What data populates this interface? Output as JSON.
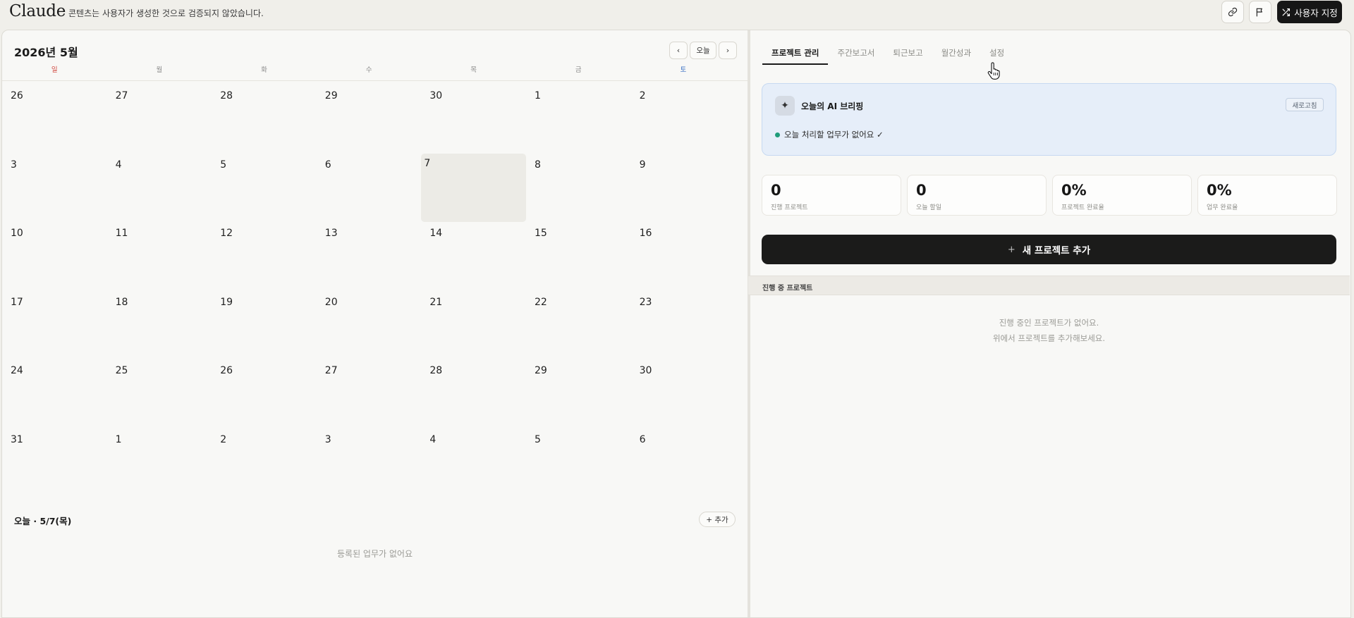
{
  "app": {
    "brand": "Claude",
    "disclaimer": "콘텐츠는 사용자가 생성한 것으로 검증되지 않았습니다.",
    "customize_label": "사용자 지정"
  },
  "calendar": {
    "title": "2026년 5월",
    "today_label": "오늘",
    "weekdays": [
      "일",
      "월",
      "화",
      "수",
      "목",
      "금",
      "토"
    ],
    "weeks": [
      [
        "26",
        "27",
        "28",
        "29",
        "30",
        "1",
        "2"
      ],
      [
        "3",
        "4",
        "5",
        "6",
        "7",
        "8",
        "9"
      ],
      [
        "10",
        "11",
        "12",
        "13",
        "14",
        "15",
        "16"
      ],
      [
        "17",
        "18",
        "19",
        "20",
        "21",
        "22",
        "23"
      ],
      [
        "24",
        "25",
        "26",
        "27",
        "28",
        "29",
        "30"
      ],
      [
        "31",
        "1",
        "2",
        "3",
        "4",
        "5",
        "6"
      ]
    ],
    "highlighted_day": "7"
  },
  "today_panel": {
    "title": "오늘 · 5/7(목)",
    "add_label": "+ 추가",
    "empty_text": "등록된 업무가 없어요"
  },
  "tabs": [
    "프로젝트 관리",
    "주간보고서",
    "퇴근보고",
    "월간성과",
    "설정"
  ],
  "briefing": {
    "icon": "sparkle-icon",
    "title": "오늘의 AI 브리핑",
    "refresh_label": "새로고침",
    "status": "오늘 처리할 업무가 없어요 ✓",
    "status_color": "#1f9c7a"
  },
  "stats": [
    {
      "value": "0",
      "label": "진행 프로젝트"
    },
    {
      "value": "0",
      "label": "오늘 할일"
    },
    {
      "value": "0%",
      "label": "프로젝트 완료율"
    },
    {
      "value": "0%",
      "label": "업무 완료율"
    }
  ],
  "new_project": {
    "plus": "+",
    "label": "새 프로젝트 추가"
  },
  "in_progress": {
    "title": "진행 중 프로젝트",
    "empty_line1": "진행 중인 프로젝트가 없어요.",
    "empty_line2": "위에서 프로젝트를 추가해보세요."
  }
}
